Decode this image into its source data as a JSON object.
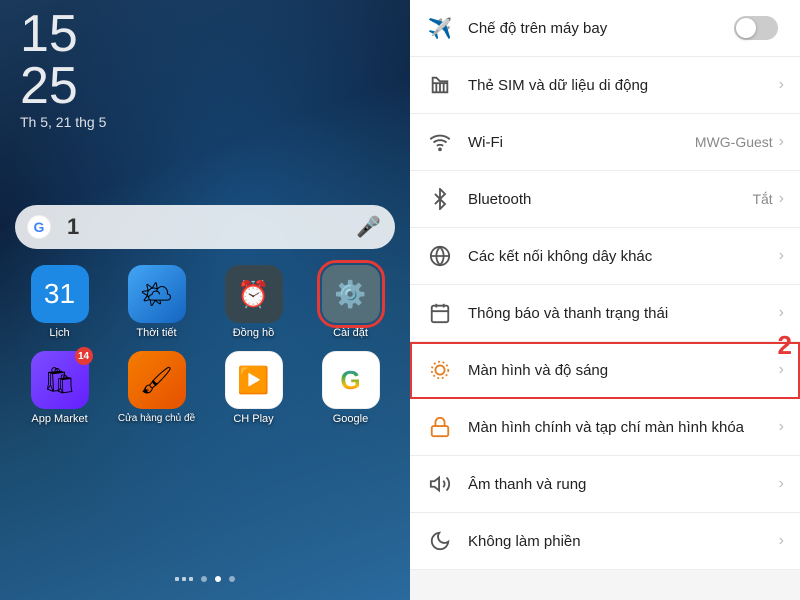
{
  "left": {
    "time": {
      "hours": "15",
      "minutes": "25",
      "date": "Th 5, 21 thg 5"
    },
    "search": {
      "placeholder": "",
      "badge_number": "1",
      "google_letter": "G"
    },
    "apps_row1": [
      {
        "name": "Lịch",
        "icon": "📅",
        "bg": "bg-calendar",
        "badge": null
      },
      {
        "name": "Thời tiết",
        "icon": "🌤️",
        "bg": "bg-weather",
        "badge": null
      },
      {
        "name": "Đồng hồ",
        "icon": "",
        "bg": "bg-clock",
        "badge": null
      },
      {
        "name": "Cài đặt",
        "icon": "⚙️",
        "bg": "bg-settings",
        "badge": null,
        "highlighted": true
      }
    ],
    "apps_row2": [
      {
        "name": "App Market",
        "icon": "🛍️",
        "bg": "bg-appmarket",
        "badge": "14"
      },
      {
        "name": "Cửa hàng chủ đề",
        "icon": "🖌️",
        "bg": "bg-store",
        "badge": null
      },
      {
        "name": "CH Play",
        "icon": "▶️",
        "bg": "bg-play",
        "badge": null
      },
      {
        "name": "Google",
        "icon": "🌐",
        "bg": "bg-google",
        "badge": null
      }
    ],
    "label1": "1",
    "nav": {
      "dots": [
        "inactive",
        "active",
        "inactive"
      ]
    }
  },
  "right": {
    "label2": "2",
    "settings_items": [
      {
        "id": "airplane",
        "icon": "✈️",
        "text": "Chế độ trên máy bay",
        "value": "",
        "has_toggle": true,
        "toggle_on": false,
        "has_chevron": false,
        "highlighted": false
      },
      {
        "id": "sim",
        "icon": "📶",
        "text": "Thẻ SIM và dữ liệu di động",
        "value": "",
        "has_toggle": false,
        "has_chevron": true,
        "highlighted": false
      },
      {
        "id": "wifi",
        "icon": "📶",
        "text": "Wi-Fi",
        "value": "MWG-Guest",
        "has_toggle": false,
        "has_chevron": true,
        "highlighted": false
      },
      {
        "id": "bluetooth",
        "icon": "🔵",
        "text": "Bluetooth",
        "value": "Tắt",
        "has_toggle": false,
        "has_chevron": true,
        "highlighted": false
      },
      {
        "id": "connections",
        "icon": "🔗",
        "text": "Các kết nối không dây khác",
        "value": "",
        "has_toggle": false,
        "has_chevron": true,
        "highlighted": false
      },
      {
        "id": "notifications",
        "icon": "🗓️",
        "text": "Thông báo và thanh trạng thái",
        "value": "",
        "has_toggle": false,
        "has_chevron": true,
        "highlighted": false
      },
      {
        "id": "display",
        "icon": "☀️",
        "text": "Màn hình và độ sáng",
        "value": "",
        "has_toggle": false,
        "has_chevron": true,
        "highlighted": true
      },
      {
        "id": "lockscreen",
        "icon": "🖼️",
        "text": "Màn hình chính và tạp chí màn hình khóa",
        "value": "",
        "has_toggle": false,
        "has_chevron": true,
        "highlighted": false
      },
      {
        "id": "sound",
        "icon": "🔊",
        "text": "Âm thanh và rung",
        "value": "",
        "has_toggle": false,
        "has_chevron": true,
        "highlighted": false
      },
      {
        "id": "dnd",
        "icon": "🌙",
        "text": "Không làm phiền",
        "value": "",
        "has_toggle": false,
        "has_chevron": true,
        "highlighted": false
      }
    ]
  }
}
